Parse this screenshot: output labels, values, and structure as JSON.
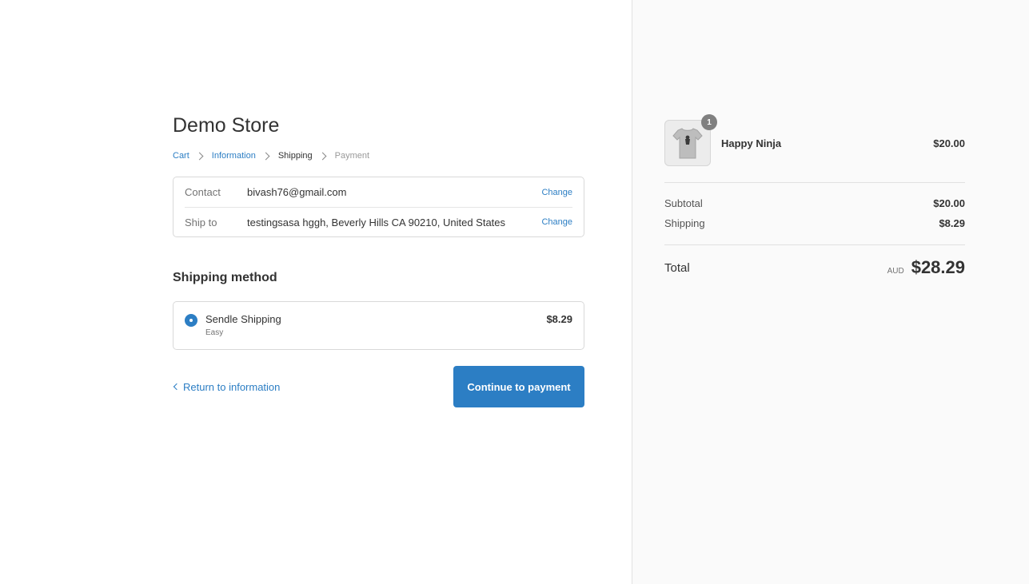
{
  "store": {
    "title": "Demo Store"
  },
  "breadcrumb": {
    "cart": "Cart",
    "information": "Information",
    "shipping": "Shipping",
    "payment": "Payment"
  },
  "review": {
    "contact_label": "Contact",
    "contact_value": "bivash76@gmail.com",
    "ship_to_label": "Ship to",
    "ship_to_value": "testingsasa hggh, Beverly Hills CA 90210, United States",
    "change_label": "Change"
  },
  "shipping_method": {
    "title": "Shipping method",
    "option_name": "Sendle Shipping",
    "option_sub": "Easy",
    "option_price": "$8.29",
    "selected": true
  },
  "actions": {
    "return_label": "Return to information",
    "continue_label": "Continue to payment"
  },
  "order": {
    "product_name": "Happy Ninja",
    "product_price": "$20.00",
    "quantity": "1",
    "product_icon": "tshirt-icon",
    "subtotal_label": "Subtotal",
    "subtotal_value": "$20.00",
    "shipping_label": "Shipping",
    "shipping_value": "$8.29",
    "total_label": "Total",
    "currency": "AUD",
    "total_value": "$28.29"
  },
  "colors": {
    "accent": "#2c7ec4",
    "sidebar_bg": "#fafafa",
    "border": "#d9d9d9"
  }
}
